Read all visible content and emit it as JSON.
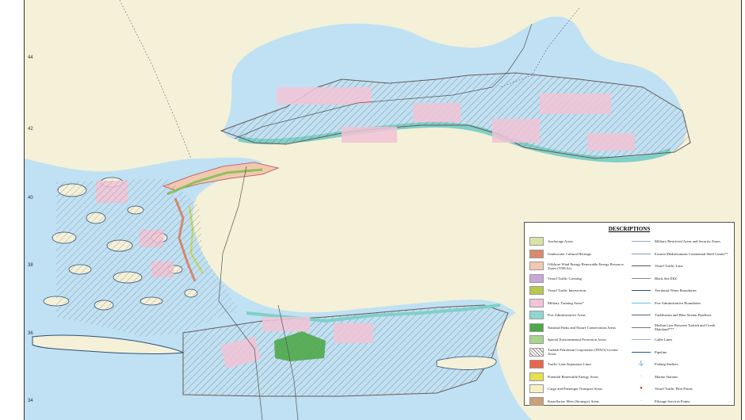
{
  "latitude_labels": [
    "44",
    "42",
    "40",
    "38",
    "36",
    "34"
  ],
  "legend": {
    "title": "DESCRIPTIONS",
    "areas": [
      {
        "label": "Anchorage Areas",
        "color": "#d8e4a4"
      },
      {
        "label": "Underwater Cultural Heritage",
        "color": "#d98a6c"
      },
      {
        "label": "Offshore Wind Energy Renewable Energy Resource Zones (YEKAs)",
        "color": "#f0c9b0"
      },
      {
        "label": "Vessel Traffic Crossing",
        "color": "#c8a8d8"
      },
      {
        "label": "Vessel Traffic Intersection",
        "color": "#b9c84c"
      },
      {
        "label": "Military Training Areas*",
        "color": "#f2c4d6"
      },
      {
        "label": "Port Administrative Areas",
        "color": "#8fd6d0"
      },
      {
        "label": "National Parks and Nature Conservation Areas",
        "color": "#4fa84a"
      },
      {
        "label": "Special Environmental Protection Areas",
        "color": "#a8d48c"
      },
      {
        "label": "Turkish Petroleum Corporation (TPAO) License Areas",
        "color": "hatch"
      },
      {
        "label": "Traffic Lane Separation Lines",
        "color": "#e8664c"
      },
      {
        "label": "Potential Renewable Energy Areas",
        "color": "#e6e04c"
      },
      {
        "label": "Cargo and Passenger Transport Areas",
        "color": "#f6f0c4"
      },
      {
        "label": "Kastellorizo Meis (Strategic) Areas",
        "color": "#caa078"
      }
    ],
    "lines": [
      {
        "label": "Military Restricted Areas and Security Zones",
        "kind": "line",
        "color": "#9aa8b8"
      },
      {
        "label": "Eastern Mediterranean Continental Shelf Limits**",
        "kind": "line",
        "color": "#8899aa"
      },
      {
        "label": "Vessel Traffic Lane",
        "kind": "line",
        "color": "#555555"
      },
      {
        "label": "Black Sea EEZ",
        "kind": "line",
        "color": "#7a8a9a"
      },
      {
        "label": "Territorial Water Boundaries",
        "kind": "line",
        "color": "#2e4e7a"
      },
      {
        "label": "Port Administrative Boundaries",
        "kind": "line",
        "color": "#5ec0e0"
      },
      {
        "label": "TurkStream and Blue Stream Pipelines",
        "kind": "line",
        "color": "#4a6a8a"
      },
      {
        "label": "Median Line Between Turkish and Greek Mainland***",
        "kind": "line",
        "color": "#6a7a8a"
      },
      {
        "label": "Cable Lines",
        "kind": "line",
        "color": "#9ab0c0"
      },
      {
        "label": "Pipeline",
        "kind": "line",
        "color": "#2a50a0"
      },
      {
        "label": "Fishing Shelters",
        "kind": "symbol",
        "symbol": "⚓"
      },
      {
        "label": "Marine Stations",
        "kind": "symbol",
        "symbol": "·"
      },
      {
        "label": "Vessel Traffic Pilot Points",
        "kind": "symbol",
        "symbol": "●",
        "color": "#e02020"
      },
      {
        "label": "Pilotage Services Points",
        "kind": "symbol",
        "symbol": "·"
      }
    ]
  }
}
